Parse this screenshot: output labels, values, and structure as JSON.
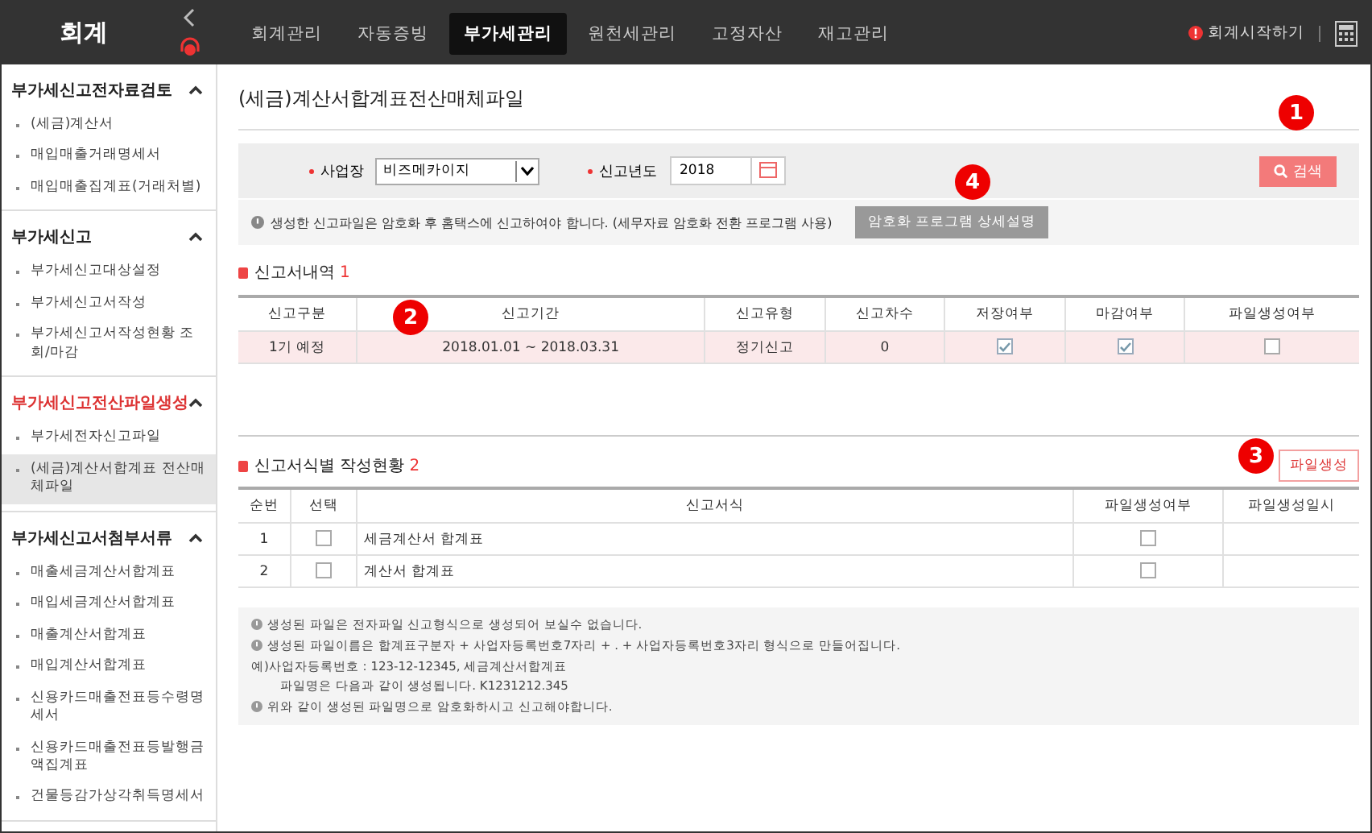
{
  "topbar": {
    "logo": "회계",
    "tabs": [
      {
        "label": "회계관리",
        "selected": false
      },
      {
        "label": "자동증빙",
        "selected": false
      },
      {
        "label": "부가세관리",
        "selected": true
      },
      {
        "label": "원천세관리",
        "selected": false
      },
      {
        "label": "고정자산",
        "selected": false
      },
      {
        "label": "재고관리",
        "selected": false
      }
    ],
    "start_link": "회계시작하기"
  },
  "sidebar": {
    "groups": [
      {
        "title": "부가세신고전자료검토",
        "active": false,
        "expanded": true,
        "items": [
          {
            "label": "(세금)계산서",
            "selected": false
          },
          {
            "label": "매입매출거래명세서",
            "selected": false
          },
          {
            "label": "매입매출집계표(거래처별)",
            "selected": false
          }
        ]
      },
      {
        "title": "부가세신고",
        "active": false,
        "expanded": true,
        "items": [
          {
            "label": "부가세신고대상설정",
            "selected": false
          },
          {
            "label": "부가세신고서작성",
            "selected": false
          },
          {
            "label": "부가세신고서작성현황 조회/마감",
            "selected": false
          }
        ]
      },
      {
        "title": "부가세신고전산파일생성",
        "active": true,
        "expanded": true,
        "items": [
          {
            "label": "부가세전자신고파일",
            "selected": false
          },
          {
            "label": "(세금)계산서합계표 전산매체파일",
            "selected": true
          }
        ]
      },
      {
        "title": "부가세신고서첨부서류",
        "active": false,
        "expanded": true,
        "items": [
          {
            "label": "매출세금계산서합계표",
            "selected": false
          },
          {
            "label": "매입세금계산서합계표",
            "selected": false
          },
          {
            "label": "매출계산서합계표",
            "selected": false
          },
          {
            "label": "매입계산서합계표",
            "selected": false
          },
          {
            "label": "신용카드매출전표등수령명세서",
            "selected": false
          },
          {
            "label": "신용카드매출전표등발행금액집계표",
            "selected": false
          },
          {
            "label": "건물등감가상각취득명세서",
            "selected": false
          }
        ]
      }
    ]
  },
  "page_title": "(세금)계산서합계표전산매체파일",
  "filter": {
    "business_label": "사업장",
    "business_value": "비즈메카이지",
    "year_label": "신고년도",
    "year_value": "2018",
    "search_button": "검색"
  },
  "notice": {
    "text": "생성한 신고파일은 암호화 후 홈택스에 신고하여야 합니다. (세무자료 암호화 전환 프로그램 사용)",
    "button": "암호화 프로그램 상세설명"
  },
  "reports": {
    "title": "신고서내역",
    "count": "1",
    "columns": [
      "신고구분",
      "신고기간",
      "신고유형",
      "신고차수",
      "저장여부",
      "마감여부",
      "파일생성여부"
    ],
    "rows": [
      {
        "category": "1기 예정",
        "period": "2018.01.01 ~ 2018.03.31",
        "type": "정기신고",
        "round": "0",
        "saved": true,
        "closed": true,
        "file_created": false,
        "selected": true
      }
    ]
  },
  "forms": {
    "title": "신고서식별 작성현황",
    "count": "2",
    "button": "파일생성",
    "columns": [
      "순번",
      "선택",
      "신고서식",
      "파일생성여부",
      "파일생성일시"
    ],
    "rows": [
      {
        "no": "1",
        "checked": false,
        "form": "세금계산서 합계표",
        "file_created": false
      },
      {
        "no": "2",
        "checked": false,
        "form": "계산서 합계표",
        "file_created": false
      }
    ]
  },
  "notes": [
    {
      "kind": "info",
      "text": "생성된 파일은 전자파일 신고형식으로 생성되어 보실수 없습니다."
    },
    {
      "kind": "info",
      "text": "생성된 파일이름은 합계표구분자 + 사업자등록번호7자리 + . + 사업자등록번호3자리 형식으로 만들어집니다."
    },
    {
      "kind": "plain",
      "text": "예)사업자등록번호 : 123-12-12345, 세금계산서합계표"
    },
    {
      "kind": "indent",
      "text": "파일명은 다음과 같이 생성됩니다. K1231212.345"
    },
    {
      "kind": "info",
      "text": "위와 같이 생성된 파일명으로 암호화하시고 신고해야합니다."
    }
  ],
  "callouts": [
    "1",
    "2",
    "3",
    "4"
  ]
}
